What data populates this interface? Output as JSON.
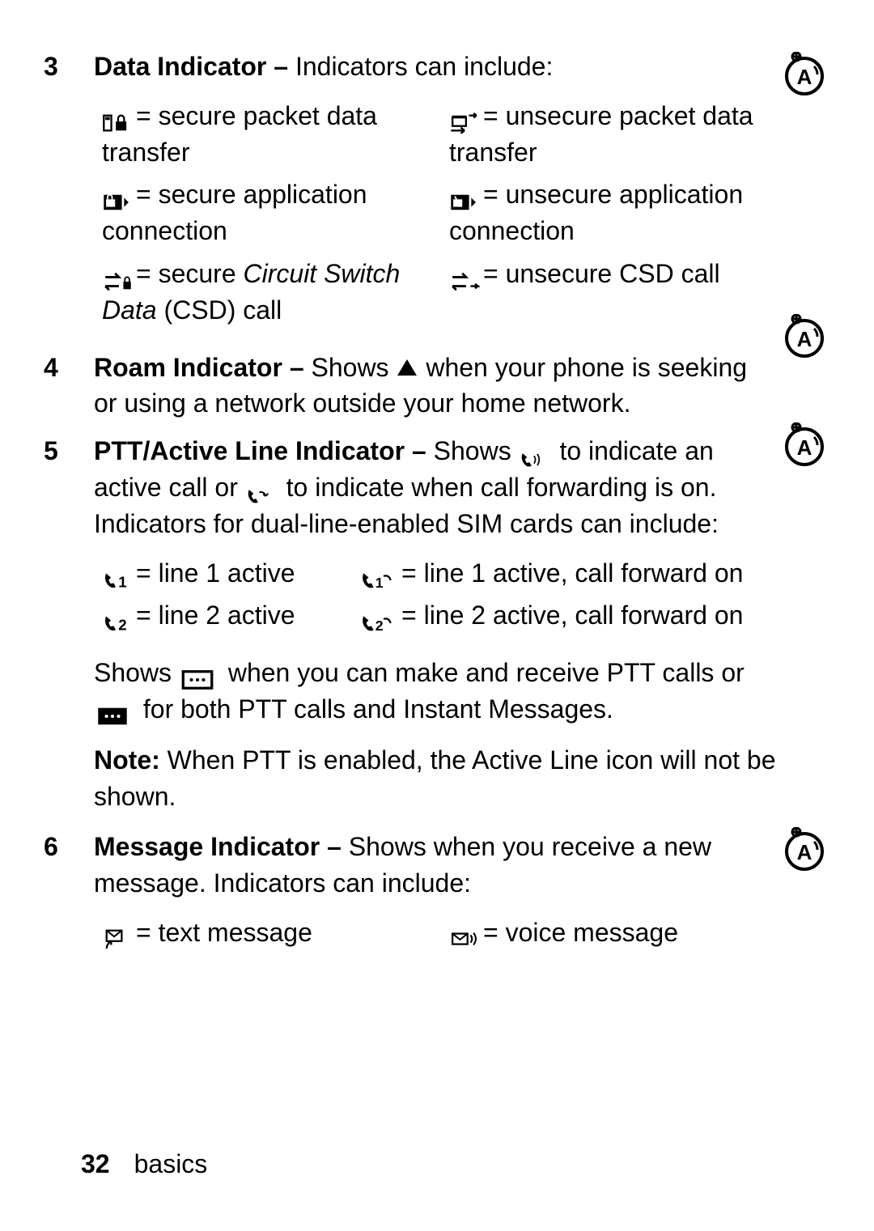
{
  "items": {
    "3": {
      "num": "3",
      "title": "Data Indicator – ",
      "tail": "Indicators can include:",
      "cells": {
        "a": "= secure packet data transfer",
        "b": "= unsecure packet data transfer",
        "c": "= secure application connection",
        "d": "= unsecure application connection",
        "e_pre": "= secure ",
        "e_it": "Circuit Switch Data",
        "e_post": " (CSD) call",
        "f": "= unsecure CSD call"
      }
    },
    "4": {
      "num": "4",
      "title": "Roam Indicator – ",
      "pre": "Shows ",
      "post": " when your phone is seeking or using a network outside your home network."
    },
    "5": {
      "num": "5",
      "title": "PTT/Active Line Indicator – ",
      "pre": "Shows ",
      "mid1": " to indicate an active call or ",
      "mid2": " to indicate when call forwarding is on. Indicators for dual-line-enabled SIM cards can include:",
      "cells": {
        "l1": "= line 1 active",
        "l1f": "= line 1 active, call forward on",
        "l2": "= line 2 active",
        "l2f": "= line 2 active, call forward on"
      },
      "ptt_pre": "Shows ",
      "ptt_mid": " when you can make and receive PTT calls or ",
      "ptt_post": " for both PTT calls and Instant Messages.",
      "note_label": "Note:",
      "note_body": " When PTT is enabled, the Active Line icon will not be shown."
    },
    "6": {
      "num": "6",
      "title": "Message Indicator – ",
      "body": "Shows when you receive a new message. Indicators can include:",
      "cells": {
        "txt": "= text message",
        "voice": "= voice message"
      }
    }
  },
  "footer": {
    "page": "32",
    "section": "basics"
  }
}
